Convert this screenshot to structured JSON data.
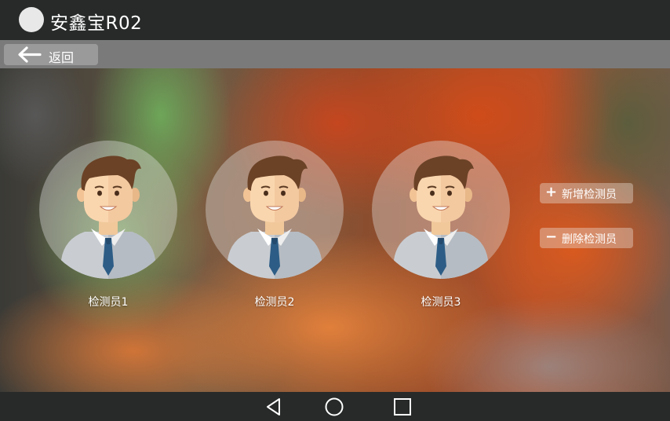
{
  "app": {
    "title": "安鑫宝R02",
    "logo_icon": "circle-logo-icon"
  },
  "back": {
    "label": "返回",
    "icon": "arrow-left-icon"
  },
  "inspectors": [
    {
      "name": "检测员1",
      "icon": "male-avatar-icon"
    },
    {
      "name": "检测员2",
      "icon": "male-avatar-icon"
    },
    {
      "name": "检测员3",
      "icon": "male-avatar-icon"
    }
  ],
  "actions": {
    "add": {
      "symbol": "+",
      "label": "新增检测员",
      "icon": "plus-icon"
    },
    "delete": {
      "symbol": "−",
      "label": "删除检测员",
      "icon": "minus-icon"
    }
  },
  "navigation": {
    "back_icon": "nav-back-triangle-icon",
    "home_icon": "nav-home-circle-icon",
    "recents_icon": "nav-recents-square-icon"
  },
  "colors": {
    "titlebar": "#272a29",
    "backbar": "#7a7a7a",
    "back_button": "#9a9a9a",
    "text": "#ffffff"
  }
}
